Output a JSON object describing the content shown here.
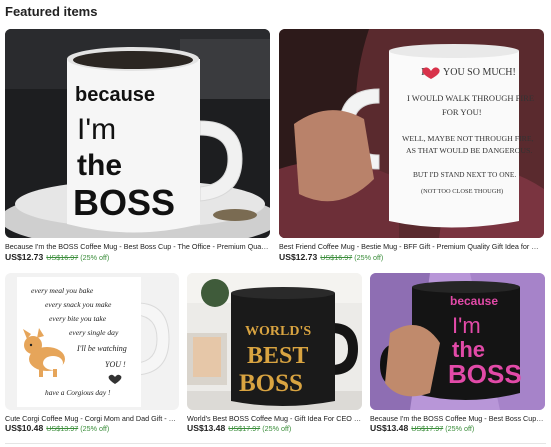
{
  "section": {
    "title": "Featured items"
  },
  "items": [
    {
      "title": "Because I'm the BOSS Coffee Mug - Best Boss Cup - The Office - Premium Quality Gi...",
      "price": "US$12.73",
      "original_price": "US$16.97",
      "discount": "(25% off)",
      "mug_text": [
        "because",
        "I'm",
        "the",
        "BOSS"
      ]
    },
    {
      "title": "Best Friend Coffee Mug - Bestie Mug - BFF Gift - Premium Quality Gift Idea for Wom...",
      "price": "US$12.73",
      "original_price": "US$16.97",
      "discount": "(25% off)",
      "mug_text": [
        "I",
        "YOU SO MUCH!",
        "I WOULD WALK THROUGH FIRE",
        "FOR YOU!",
        "WELL, MAYBE NOT THROUGH FIRE,",
        "AS THAT WOULD BE DANGEROUS.",
        "BUT I'D STAND NEXT TO ONE.",
        "(NOT TOO CLOSE THOUGH)"
      ]
    },
    {
      "title": "Cute Corgi Coffee Mug - Corgi Mom and Dad Gift - Pe...",
      "price": "US$10.48",
      "original_price": "US$13.97",
      "discount": "(25% off)",
      "mug_text": [
        "every meal you bake",
        "every snack you make",
        "every bite you take",
        "every single day",
        "I'll be watching",
        "YOU !",
        "have a Corgious day !"
      ]
    },
    {
      "title": "World's Best BOSS Coffee Mug - Gift Idea For CEO or ...",
      "price": "US$13.48",
      "original_price": "US$17.97",
      "discount": "(25% off)",
      "mug_text": [
        "WORLD'S",
        "BEST",
        "BOSS"
      ]
    },
    {
      "title": "Because I'm the BOSS Coffee Mug - Best Boss Cup - T...",
      "price": "US$13.48",
      "original_price": "US$17.97",
      "discount": "(25% off)",
      "mug_text": [
        "because",
        "I'm",
        "the",
        "BOSS"
      ]
    }
  ],
  "colors": {
    "discount_green": "#3a8d3a",
    "gold": "#d9a441",
    "pink": "#e24aa8"
  }
}
